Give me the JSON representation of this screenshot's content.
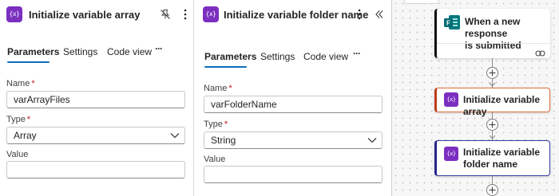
{
  "panel_left": {
    "title": "Initialize variable array",
    "icon": "variable-icon",
    "icon_text": "{x}",
    "tabs": [
      "Parameters",
      "Settings",
      "Code view"
    ],
    "more_tabs": "···",
    "fields": {
      "name_label": "Name",
      "name_value": "varArrayFiles",
      "type_label": "Type",
      "type_value": "Array",
      "value_label": "Value",
      "required_mark": "*"
    }
  },
  "panel_right": {
    "title": "Initialize variable folder name",
    "icon": "variable-icon",
    "icon_text": "{x}",
    "tabs": [
      "Parameters",
      "Settings",
      "Code view"
    ],
    "more_tabs": "···",
    "fields": {
      "name_label": "Name",
      "name_value": "varFolderName",
      "type_label": "Type",
      "type_value": "String",
      "value_label": "Value",
      "required_mark": "*"
    }
  },
  "flow": {
    "trigger": {
      "title_line1": "When a new response",
      "title_line2": "is submitted",
      "icon": "forms-icon",
      "link_icon": "link-icon"
    },
    "action1": {
      "title": "Initialize variable array",
      "icon_text": "{x}",
      "selected_color": "#e06c3a"
    },
    "action2": {
      "title_line1": "Initialize variable",
      "title_line2": "folder name",
      "icon_text": "{x}",
      "selected_color": "#3a3aaa"
    }
  },
  "colors": {
    "accent": "#0f6cbd",
    "variable_icon": "#7b2fbf",
    "required": "#c50f1f"
  }
}
